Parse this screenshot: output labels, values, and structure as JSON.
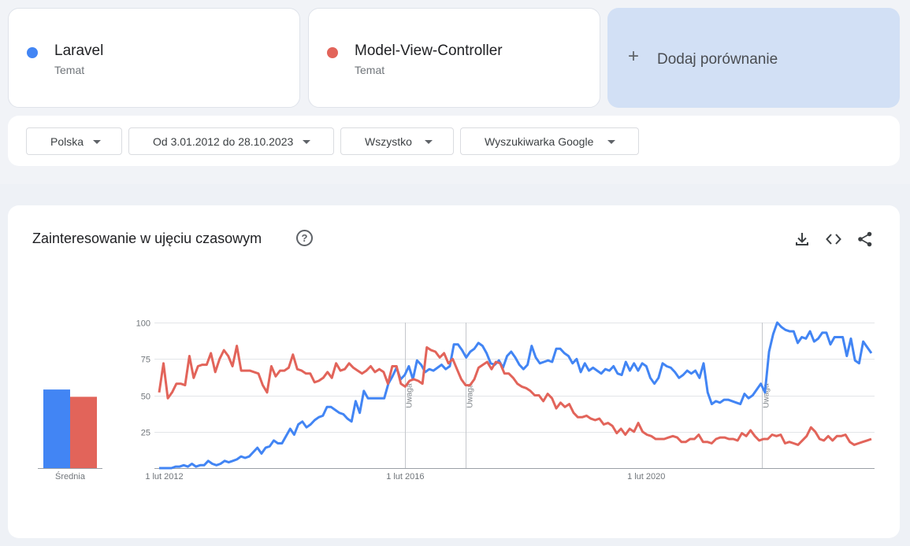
{
  "terms": [
    {
      "name": "Laravel",
      "type": "Temat",
      "color": "#4285f4"
    },
    {
      "name": "Model-View-Controller",
      "type": "Temat",
      "color": "#e2645a"
    }
  ],
  "add_comparison": {
    "label": "Dodaj porównanie"
  },
  "filters": {
    "region": "Polska",
    "date_range": "Od 3.01.2012 do 28.10.2023",
    "category": "Wszystko",
    "source": "Wyszukiwarka Google"
  },
  "chart_section": {
    "title": "Zainteresowanie w ujęciu czasowym",
    "toolbar_icons": [
      "download-icon",
      "embed-code-icon",
      "share-icon"
    ]
  },
  "chart_data": [
    {
      "type": "bar",
      "title": "",
      "categories": [
        "Średnia"
      ],
      "series": [
        {
          "name": "Laravel",
          "values": [
            54
          ],
          "color": "#4285f4"
        },
        {
          "name": "Model-View-Controller",
          "values": [
            49
          ],
          "color": "#e2645a"
        }
      ],
      "ylim": [
        0,
        100
      ]
    },
    {
      "type": "line",
      "title": "",
      "xlabel": "",
      "ylabel": "",
      "x_range": [
        "2012-01-01",
        "2023-10-28"
      ],
      "x_ticks": [
        {
          "date": "2012-02-01",
          "label": "1 lut 2012"
        },
        {
          "date": "2016-02-01",
          "label": "1 lut 2016"
        },
        {
          "date": "2020-02-01",
          "label": "1 lut 2020"
        }
      ],
      "y_ticks": [
        25,
        50,
        75,
        100
      ],
      "ylim": [
        0,
        100
      ],
      "grid": true,
      "annotations": [
        {
          "date": "2016-02-01",
          "label": "Uwaga"
        },
        {
          "date": "2017-02-01",
          "label": "Uwaga"
        },
        {
          "date": "2022-01-01",
          "label": "Uwaga"
        }
      ],
      "series": [
        {
          "name": "Laravel",
          "color": "#4285f4",
          "values": [
            0,
            0,
            0,
            0,
            1,
            1,
            2,
            1,
            3,
            1,
            2,
            2,
            5,
            3,
            2,
            3,
            5,
            4,
            5,
            6,
            8,
            7,
            8,
            11,
            14,
            10,
            14,
            15,
            19,
            17,
            17,
            22,
            27,
            23,
            30,
            32,
            28,
            30,
            33,
            35,
            36,
            42,
            42,
            40,
            38,
            37,
            34,
            32,
            46,
            38,
            53,
            48,
            48,
            48,
            48,
            48,
            58,
            63,
            69,
            61,
            64,
            70,
            61,
            74,
            71,
            66,
            68,
            67,
            69,
            71,
            68,
            70,
            85,
            85,
            81,
            76,
            80,
            82,
            86,
            84,
            79,
            72,
            71,
            74,
            69,
            77,
            80,
            76,
            71,
            68,
            71,
            84,
            76,
            72,
            73,
            74,
            73,
            82,
            82,
            79,
            77,
            72,
            75,
            66,
            72,
            67,
            69,
            67,
            65,
            68,
            67,
            70,
            65,
            64,
            73,
            67,
            72,
            67,
            72,
            70,
            62,
            58,
            62,
            72,
            70,
            69,
            66,
            62,
            64,
            67,
            65,
            67,
            62,
            72,
            52,
            44,
            46,
            45,
            47,
            47,
            46,
            45,
            44,
            51,
            48,
            50,
            54,
            58,
            52,
            80,
            92,
            100,
            97,
            95,
            94,
            94,
            86,
            90,
            89,
            94,
            87,
            89,
            93,
            93,
            85,
            90,
            90,
            90,
            77,
            89,
            74,
            72,
            87,
            83,
            79
          ]
        },
        {
          "name": "Model-View-Controller",
          "color": "#e2645a",
          "values": [
            52,
            72,
            48,
            52,
            58,
            58,
            57,
            77,
            62,
            70,
            71,
            71,
            79,
            66,
            75,
            81,
            77,
            70,
            84,
            67,
            67,
            67,
            66,
            65,
            57,
            52,
            70,
            63,
            67,
            67,
            69,
            78,
            68,
            67,
            65,
            65,
            59,
            60,
            62,
            66,
            62,
            72,
            67,
            68,
            72,
            69,
            67,
            65,
            67,
            70,
            66,
            68,
            66,
            58,
            70,
            70,
            58,
            56,
            60,
            61,
            60,
            58,
            83,
            81,
            80,
            76,
            79,
            72,
            75,
            68,
            61,
            57,
            57,
            61,
            69,
            71,
            73,
            68,
            73,
            72,
            65,
            65,
            62,
            58,
            56,
            55,
            53,
            50,
            50,
            46,
            51,
            48,
            41,
            45,
            42,
            44,
            38,
            35,
            35,
            36,
            34,
            33,
            34,
            30,
            31,
            29,
            24,
            27,
            23,
            27,
            25,
            31,
            25,
            23,
            22,
            20,
            20,
            20,
            21,
            22,
            21,
            18,
            18,
            20,
            20,
            23,
            18,
            18,
            17,
            20,
            21,
            21,
            20,
            20,
            19,
            24,
            22,
            26,
            22,
            19,
            20,
            20,
            23,
            22,
            23,
            17,
            18,
            17,
            16,
            19,
            22,
            28,
            25,
            20,
            19,
            22,
            19,
            22,
            22,
            23,
            18,
            16,
            17,
            18,
            19,
            20
          ]
        }
      ]
    }
  ]
}
